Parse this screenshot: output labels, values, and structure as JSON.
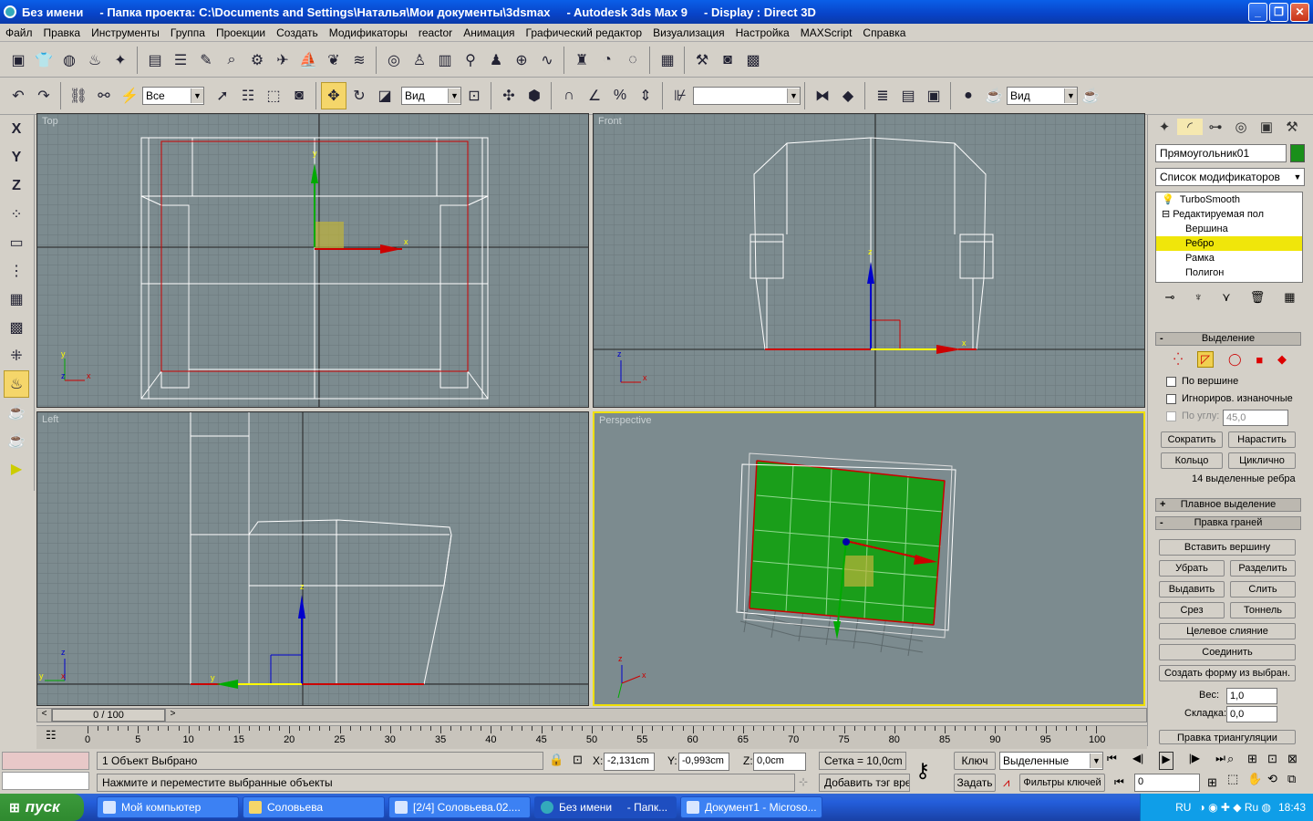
{
  "window": {
    "title": "Без имени     - Папка проекта: C:\\Documents and Settings\\Наталья\\Мои документы\\3dsmax     - Autodesk 3ds Max 9     - Display : Direct 3D"
  },
  "menu": [
    "Файл",
    "Правка",
    "Инструменты",
    "Группа",
    "Проекции",
    "Создать",
    "Модификаторы",
    "reactor",
    "Анимация",
    "Графический редактор",
    "Визуализация",
    "Настройка",
    "MAXScript",
    "Справка"
  ],
  "toolbar2": {
    "selection_filter": "Все",
    "ref_coord": "Вид",
    "named_sel": "",
    "render_type": "Вид"
  },
  "viewports": {
    "top": "Top",
    "front": "Front",
    "left": "Left",
    "perspective": "Perspective"
  },
  "panel": {
    "object_name": "Прямоугольник01",
    "object_color": "#1a8f1a",
    "modifier_list": "Список модификаторов",
    "stack": [
      "TurboSmooth",
      "Редактируемая пол",
      "Вершина",
      "Ребро",
      "Рамка",
      "Полигон"
    ],
    "selection_header": "Выделение",
    "by_vertex": "По вершине",
    "ignore_backfacing": "Игнориров. изнаночные",
    "by_angle": "По углу:",
    "angle_value": "45,0",
    "shrink": "Сократить",
    "grow": "Нарастить",
    "ring": "Кольцо",
    "loop": "Циклично",
    "selected_info": "14 выделенные ребра",
    "soft_selection": "Плавное выделение",
    "edit_edges": "Правка граней",
    "insert_vertex": "Вставить вершину",
    "remove": "Убрать",
    "split": "Разделить",
    "extrude": "Выдавить",
    "weld": "Слить",
    "chamfer": "Срез",
    "bridge": "Тоннель",
    "target_weld": "Целевое слияние",
    "connect": "Соединить",
    "create_shape": "Создать форму из выбран.",
    "weight_label": "Вес:",
    "weight_value": "1,0",
    "crease_label": "Складка:",
    "crease_value": "0,0",
    "edit_tri": "Правка триангуляции"
  },
  "timeline": {
    "frame": "0 / 100",
    "ticks": [
      "0",
      "5",
      "10",
      "15",
      "20",
      "25",
      "30",
      "35",
      "40",
      "45",
      "50",
      "55",
      "60",
      "65",
      "70",
      "75",
      "80",
      "85",
      "90",
      "95",
      "100"
    ]
  },
  "status": {
    "selected": "1 Объект Выбрано",
    "prompt": "Нажмите и переместите выбранные объекты",
    "x_label": "X:",
    "x": "-2,131cm",
    "y_label": "Y:",
    "y": "-0,993cm",
    "z_label": "Z:",
    "z": "0,0cm",
    "grid": "Сетка = 10,0cm",
    "add_tag": "Добавить тэг врем",
    "key_label": "Ключ",
    "set_label": "Задать",
    "key_mode": "Выделенные",
    "key_filters": "Фильтры ключей",
    "frame_value": "0"
  },
  "taskbar": {
    "start": "пуск",
    "tasks": [
      "Мой компьютер",
      "Соловьева",
      "[2/4] Соловьева.02....",
      "Без имени     - Папк...",
      "Документ1 - Microso..."
    ],
    "lang": "RU",
    "clock": "18:43"
  }
}
